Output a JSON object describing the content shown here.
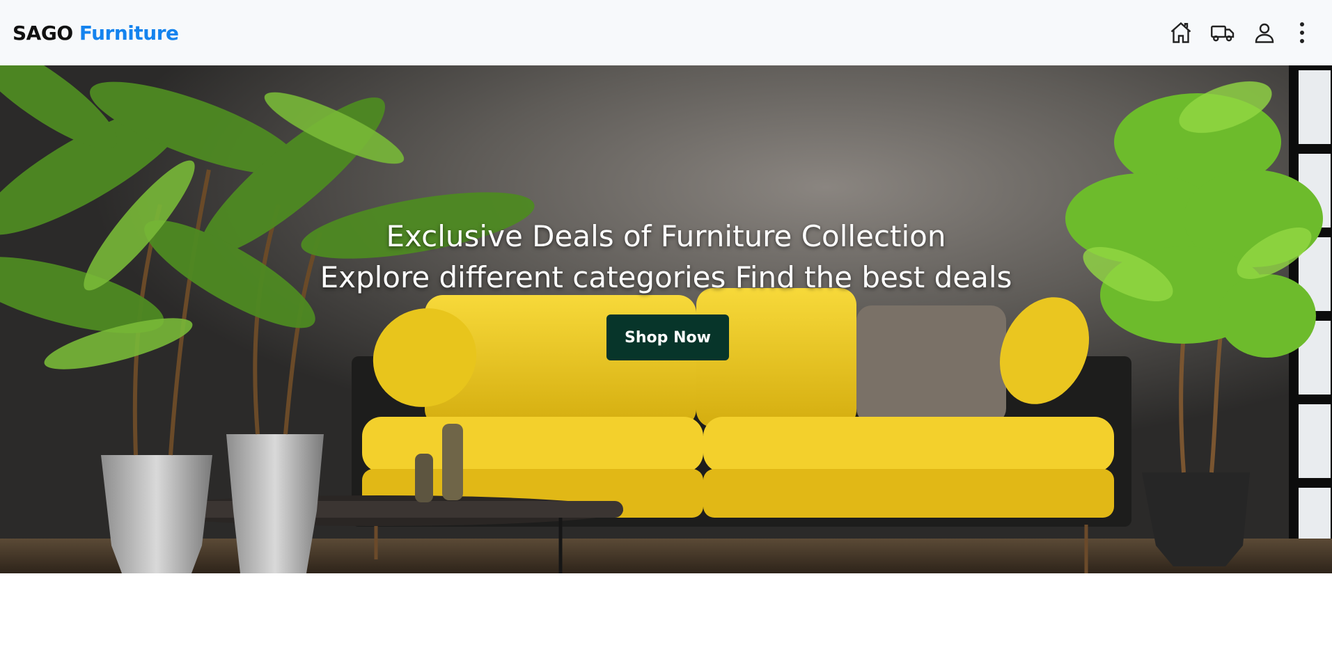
{
  "brand": {
    "name_part1": "SAGO",
    "name_part2": "Furniture"
  },
  "nav": {
    "icons": [
      "home-icon",
      "truck-icon",
      "user-icon",
      "more-vertical-icon"
    ]
  },
  "hero": {
    "title_line1": "Exclusive Deals of Furniture Collection",
    "title_line2": "Explore different categories Find the best deals",
    "cta_label": "Shop Now"
  },
  "colors": {
    "brand_accent": "#1483ee",
    "cta_background": "#07352a",
    "navbar_background": "#f7f9fb"
  }
}
